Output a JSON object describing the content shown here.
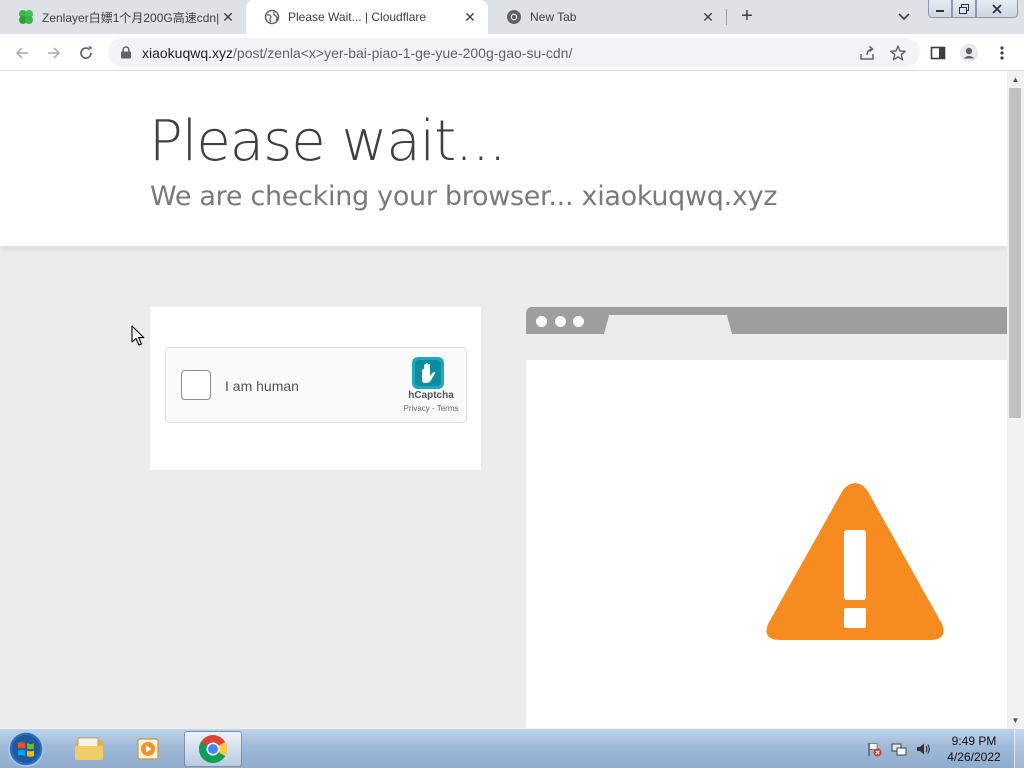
{
  "browser": {
    "tabs": [
      {
        "title": "Zenlayer白嫖1个月200G高速cdn|",
        "favicon": "green-clover-icon",
        "active": false
      },
      {
        "title": "Please Wait... | Cloudflare",
        "favicon": "globe-icon",
        "active": true
      },
      {
        "title": "New Tab",
        "favicon": "chrome-icon",
        "active": false
      }
    ],
    "new_tab_label": "+",
    "address": {
      "host": "xiaokuqwq.xyz",
      "path": "/post/zenla<x>yer-bai-piao-1-ge-yue-200g-gao-su-cdn/"
    }
  },
  "page": {
    "headline": "Please wait...",
    "subheadline": "We are checking your browser... xiaokuqwq.xyz",
    "captcha": {
      "checkbox_label": "I am human",
      "brand": "hCaptcha",
      "links": "Privacy - Terms"
    }
  },
  "colors": {
    "warning": "#f68b1f",
    "hcaptcha": "#00838f"
  },
  "taskbar": {
    "items": [
      "start-orb-icon",
      "explorer-icon",
      "media-player-icon",
      "chrome-icon"
    ],
    "tray_icons": [
      "action-center-flag-icon",
      "network-icon",
      "volume-icon"
    ],
    "time": "9:49 PM",
    "date": "4/26/2022"
  }
}
